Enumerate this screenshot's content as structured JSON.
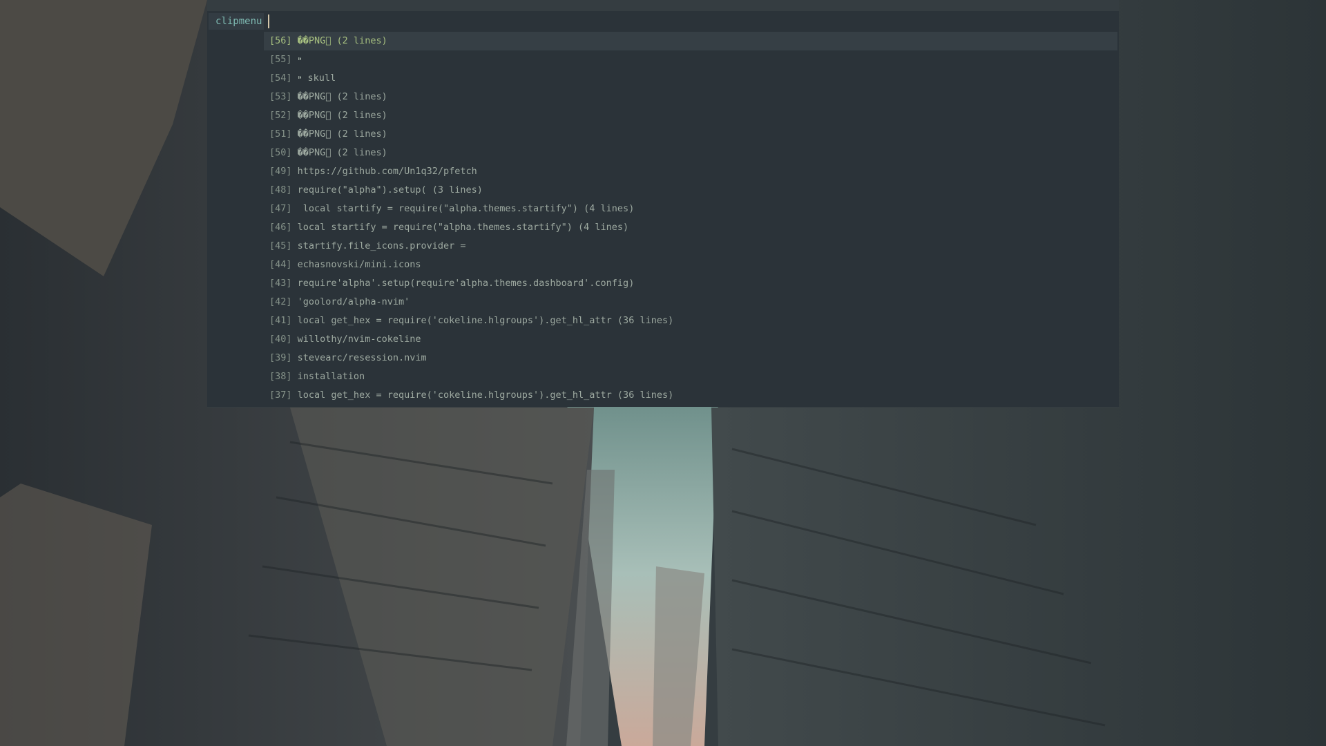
{
  "menu": {
    "prompt": "clipmenu",
    "input_value": "",
    "selected_index": 0,
    "items": [
      {
        "index": "[56]",
        "text": "��PNG⃞ (2 lines)"
      },
      {
        "index": "[55]",
        "text": "⁍"
      },
      {
        "index": "[54]",
        "text": "⁍ skull"
      },
      {
        "index": "[53]",
        "text": "��PNG⃞ (2 lines)"
      },
      {
        "index": "[52]",
        "text": "��PNG⃞ (2 lines)"
      },
      {
        "index": "[51]",
        "text": "��PNG⃞ (2 lines)"
      },
      {
        "index": "[50]",
        "text": "��PNG⃞ (2 lines)"
      },
      {
        "index": "[49]",
        "text": "https://github.com/Un1q32/pfetch"
      },
      {
        "index": "[48]",
        "text": "require(\"alpha\").setup( (3 lines)"
      },
      {
        "index": "[47]",
        "text": " local startify = require(\"alpha.themes.startify\") (4 lines)"
      },
      {
        "index": "[46]",
        "text": "local startify = require(\"alpha.themes.startify\") (4 lines)"
      },
      {
        "index": "[45]",
        "text": "startify.file_icons.provider ="
      },
      {
        "index": "[44]",
        "text": "echasnovski/mini.icons"
      },
      {
        "index": "[43]",
        "text": "require'alpha'.setup(require'alpha.themes.dashboard'.config)"
      },
      {
        "index": "[42]",
        "text": "'goolord/alpha-nvim'"
      },
      {
        "index": "[41]",
        "text": "local get_hex = require('cokeline.hlgroups').get_hl_attr (36 lines)"
      },
      {
        "index": "[40]",
        "text": "willothy/nvim-cokeline"
      },
      {
        "index": "[39]",
        "text": "stevearc/resession.nvim"
      },
      {
        "index": "[38]",
        "text": "installation"
      },
      {
        "index": "[37]",
        "text": "local get_hex = require('cokeline.hlgroups').get_hl_attr (36 lines)"
      }
    ]
  },
  "colors": {
    "menu_bg": "#2b3339",
    "selected_bg": "#363f45",
    "prompt_fg": "#7fbbb3",
    "selected_fg": "#a7c080",
    "item_fg": "#9da9a0"
  }
}
